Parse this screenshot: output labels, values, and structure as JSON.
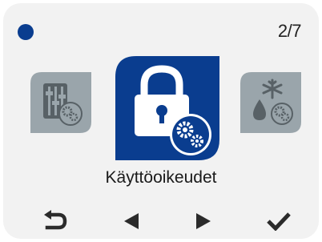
{
  "header": {
    "status_indicator_color": "#0a3d8f",
    "page_counter": "2/7"
  },
  "carousel": {
    "previous_item_icon": "settings-sliders-gears-icon",
    "selected_item_icon": "lock-gears-icon",
    "selected_item_label": "Käyttöoikeudet",
    "next_item_icon": "snowflake-droplet-gears-icon"
  },
  "nav": {
    "back_icon": "back-arrow-icon",
    "previous_icon": "left-triangle-icon",
    "next_icon": "right-triangle-icon",
    "confirm_icon": "checkmark-icon"
  },
  "colors": {
    "selected_tile": "#0a3d8f",
    "inactive_tile": "#9aa5ab",
    "inactive_icon_dark": "#586166",
    "icon_light": "#ffffff",
    "nav_icon": "#2b2b2b"
  }
}
